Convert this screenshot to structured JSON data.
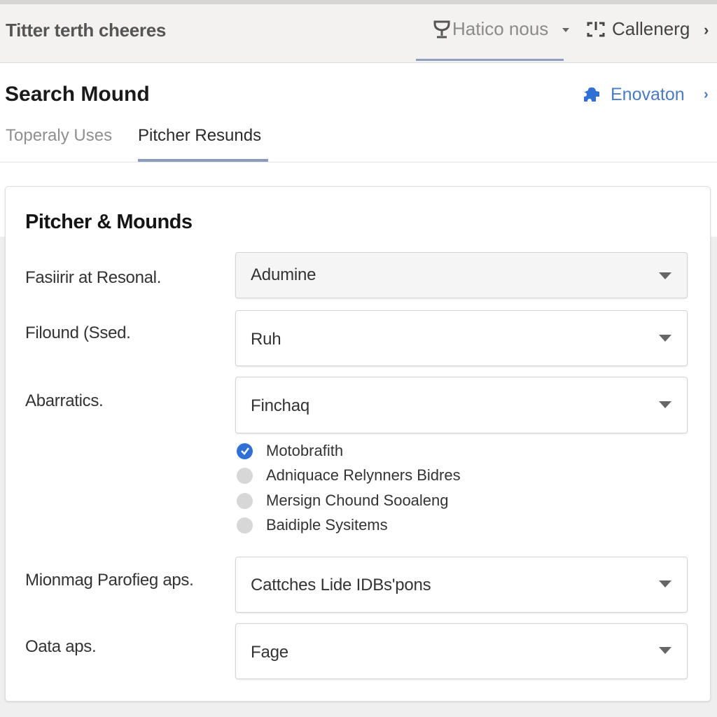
{
  "app": {
    "title": "Titter terth cheeres"
  },
  "top_nav": {
    "items": [
      {
        "label": "Hatico nous",
        "icon": "trophy-icon",
        "active": true,
        "has_dropdown": true
      },
      {
        "label": "Callenerg",
        "icon": "focus-frame-icon",
        "active": false
      }
    ],
    "chevron": "›"
  },
  "header": {
    "title": "Search Mound",
    "action": {
      "label": "Enovaton",
      "icon": "puzzle-icon"
    },
    "action_chevron": "›"
  },
  "tabs": [
    {
      "label": "Toperaly Uses",
      "active": false
    },
    {
      "label": "Pitcher Resunds",
      "active": true
    }
  ],
  "colors": {
    "accent": "#2f6fd6",
    "link": "#4a7bc2",
    "tab_underline": "#8a9bbd"
  },
  "form": {
    "title": "Pitcher & Mounds",
    "fields": [
      {
        "label": "Fasiirir at Resonal.",
        "value": "Adumine"
      },
      {
        "label": "Filound (Ssed.",
        "value": "Ruh"
      },
      {
        "label": "Abarratics.",
        "value": "Finchaq"
      },
      {
        "label": "Mionmag Parofieg aps.",
        "value": "Cattches Lide IDBs'pons"
      },
      {
        "label": "Oata aps.",
        "value": "Fage"
      }
    ],
    "options": [
      {
        "label": "Motobrafith",
        "checked": true
      },
      {
        "label": "Adniquace Relynners Bidres",
        "checked": false
      },
      {
        "label": "Mersign Chound Sooaleng",
        "checked": false
      },
      {
        "label": "Baidiple Sysitems",
        "checked": false
      }
    ]
  }
}
